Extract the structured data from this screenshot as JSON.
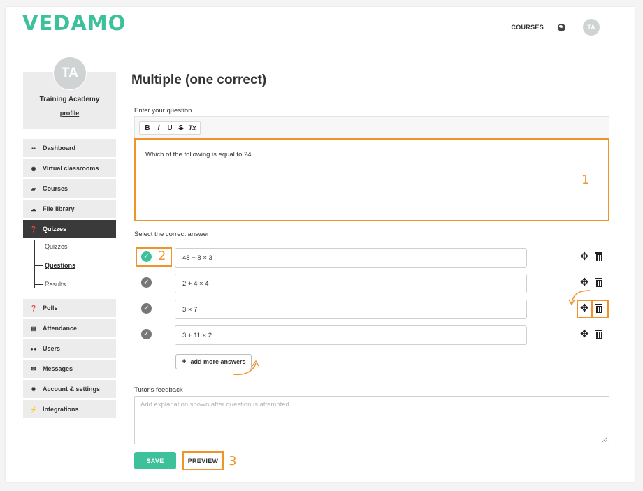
{
  "header": {
    "logo": "VEDAMO",
    "nav_courses": "COURSES",
    "avatar_initials": "TA",
    "globe_icon": "globe-icon"
  },
  "sidebar": {
    "profile": {
      "initials": "TA",
      "name": "Training Academy",
      "link": "profile"
    },
    "items": [
      {
        "label": "Dashboard",
        "icon": "dashboard-icon"
      },
      {
        "label": "Virtual classrooms",
        "icon": "virtual-classrooms-icon"
      },
      {
        "label": "Courses",
        "icon": "book-icon"
      },
      {
        "label": "File library",
        "icon": "cloud-upload-icon"
      },
      {
        "label": "Quizzes",
        "icon": "question-circle-icon",
        "active": true
      },
      {
        "label": "Polls",
        "icon": "question-circle-icon"
      },
      {
        "label": "Attendance",
        "icon": "document-icon"
      },
      {
        "label": "Users",
        "icon": "users-icon"
      },
      {
        "label": "Messages",
        "icon": "envelope-icon"
      },
      {
        "label": "Account & settings",
        "icon": "gear-icon"
      },
      {
        "label": "Integrations",
        "icon": "plug-icon"
      }
    ],
    "quizzes_submenu": [
      {
        "label": "Quizzes"
      },
      {
        "label": "Questions",
        "active": true
      },
      {
        "label": "Results"
      }
    ]
  },
  "main": {
    "title": "Multiple (one correct)",
    "question_label": "Enter your question",
    "toolbar": [
      "B",
      "I",
      "U",
      "S",
      "Tx"
    ],
    "question_text": "Which of the following is equal to 24.",
    "answers_label": "Select the correct answer",
    "answers": [
      {
        "text": "48 − 8 × 3",
        "correct": true
      },
      {
        "text": "2 + 4 × 4",
        "correct": false
      },
      {
        "text": "3 × 7",
        "correct": false
      },
      {
        "text": "3 + 11 × 2",
        "correct": false
      }
    ],
    "add_answers_label": "add more answers",
    "feedback_label": "Tutor's feedback",
    "feedback_placeholder": "Add explanation shown after question is attempted",
    "save_label": "SAVE",
    "preview_label": "PREVIEW"
  },
  "annotations": {
    "marker_1": "1",
    "marker_2": "2",
    "marker_3": "3",
    "accent_color": "#f0932b"
  },
  "colors": {
    "brand": "#3cc19b",
    "sidebar_bg": "#ececec",
    "sidebar_active": "#3a3a3a"
  }
}
